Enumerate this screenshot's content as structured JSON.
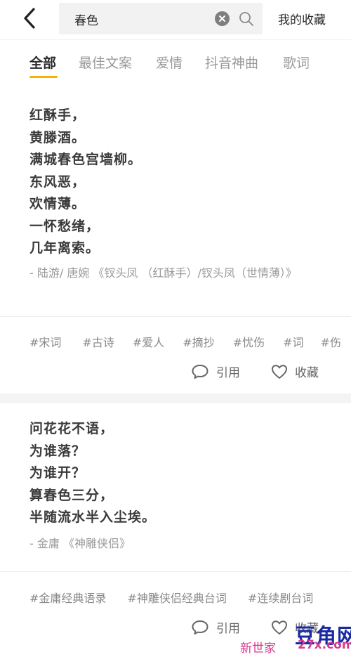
{
  "header": {
    "search_value": "春色",
    "favorites_label": "我的收藏"
  },
  "tabs": [
    {
      "label": "全部",
      "active": true
    },
    {
      "label": "最佳文案",
      "active": false
    },
    {
      "label": "爱情",
      "active": false
    },
    {
      "label": "抖音神曲",
      "active": false
    },
    {
      "label": "歌词",
      "active": false
    }
  ],
  "cards": [
    {
      "lines": [
        "红酥手，",
        "黄滕酒。",
        "满城春色宫墙柳。",
        "东风恶，",
        "欢情薄。",
        "一怀愁绪，",
        "几年离索。"
      ],
      "attribution": "- 陆游/ 唐婉 《钗头凤 （红酥手）/钗头凤（世情薄）》",
      "tags": [
        "#宋词",
        "#古诗",
        "#爱人",
        "#摘抄",
        "#忧伤",
        "#词",
        "#伤"
      ],
      "cite_label": "引用",
      "collect_label": "收藏"
    },
    {
      "lines": [
        "问花花不语，",
        "为谁落？",
        "为谁开？",
        "算春色三分，",
        "半随流水半入尘埃。"
      ],
      "attribution": "- 金庸 《神雕侠侣》",
      "tags": [
        "#金庸经典语录",
        "#神雕侠侣经典台词",
        "#连续剧台词"
      ],
      "cite_label": "引用",
      "collect_label": "收藏"
    }
  ],
  "watermark": {
    "main": "豆角网",
    "sub": "新世家",
    "domain": "27x.com"
  },
  "colors": {
    "accent": "#f6b400",
    "text_dark": "#2a2a2a",
    "text_muted": "#9a9a9a"
  }
}
